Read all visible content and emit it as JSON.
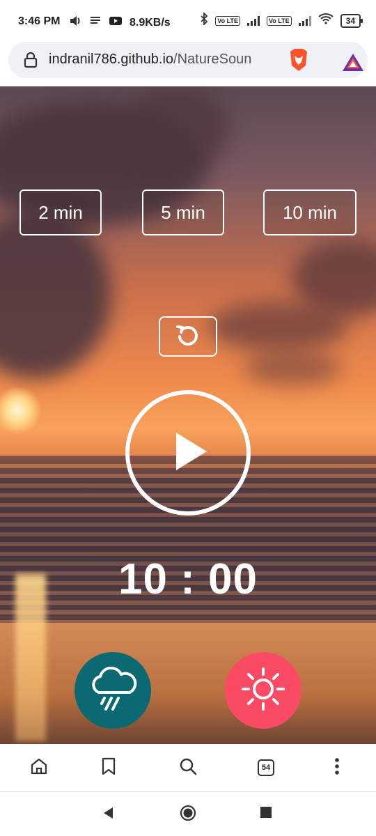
{
  "status_bar": {
    "time": "3:46 PM",
    "net_speed": "8.9KB/s",
    "volte_1": "Vo LTE",
    "volte_2": "Vo LTE",
    "battery": "34"
  },
  "browser": {
    "url_host": "indranil786.github.io",
    "url_path": "/NatureSoun",
    "tab_count": "54"
  },
  "app": {
    "time_options": [
      "2 min",
      "5 min",
      "10 min"
    ],
    "timer": "10 : 00",
    "colors": {
      "rain_button": "#0d6971",
      "sun_button": "#fb4a63"
    }
  },
  "icons": {
    "reset": "reset-icon",
    "play": "play-icon",
    "rain": "rain-cloud-icon",
    "sun": "sun-icon"
  }
}
